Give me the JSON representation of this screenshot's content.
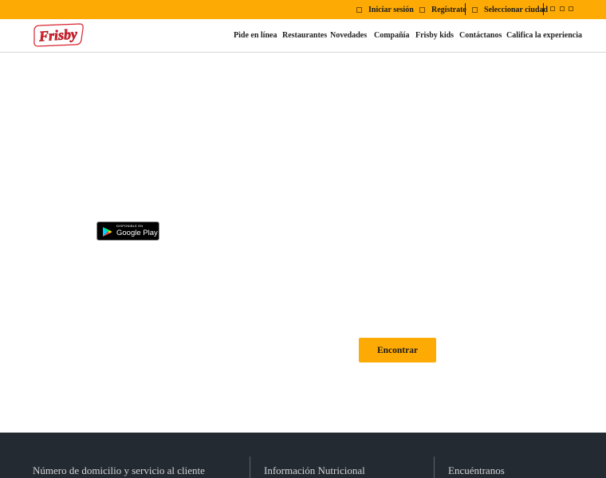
{
  "topbar": {
    "login": "Iniciar sesión",
    "register": "Regístrate",
    "city": "Seleccionar ciudad",
    "social_icons": [
      "square-icon",
      "square-icon",
      "square-icon"
    ]
  },
  "brand": {
    "logo_text": "Frisby",
    "accent": "#fdaa05",
    "logo_red": "#d9232e"
  },
  "nav": [
    "Pide en línea",
    "Restaurantes",
    "Novedades",
    "Compañía",
    "Frisby kids",
    "Contáctanos",
    "Califica la experiencia"
  ],
  "main": {
    "store_badge_small": "DISPONIBLE EN",
    "store_badge_big": "Google Play",
    "find_button": "Encontrar"
  },
  "footer": {
    "colors": {
      "background": "#232a31"
    },
    "columns": [
      "Número de domicilio y servicio al cliente",
      "Información Nutricional",
      "Encuéntranos"
    ]
  }
}
